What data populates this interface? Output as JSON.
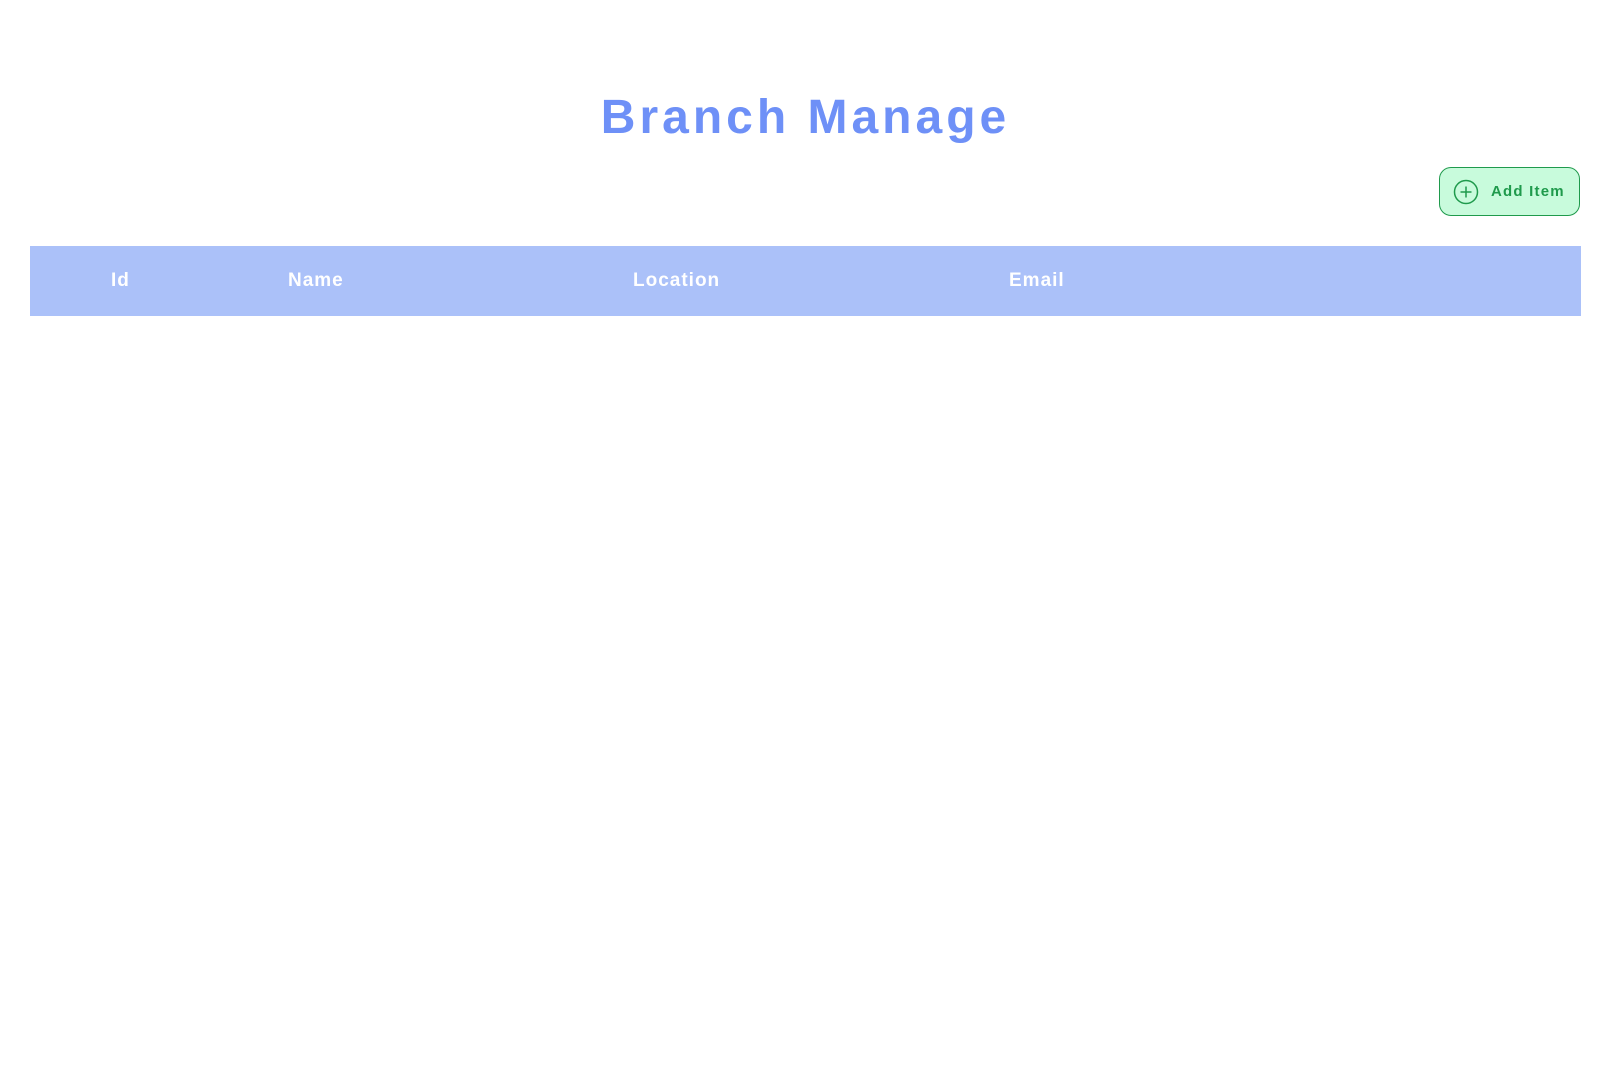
{
  "page": {
    "title": "Branch Manage"
  },
  "toolbar": {
    "add_label": "Add Item",
    "add_icon": "plus-circle-icon"
  },
  "table": {
    "columns": [
      "Id",
      "Name",
      "Location",
      "Email"
    ],
    "rows": []
  },
  "colors": {
    "title": "#6e90f7",
    "header_bg": "#abc1f9",
    "add_button_bg": "#c8fbdc",
    "add_button_accent": "#1f9a4c"
  }
}
